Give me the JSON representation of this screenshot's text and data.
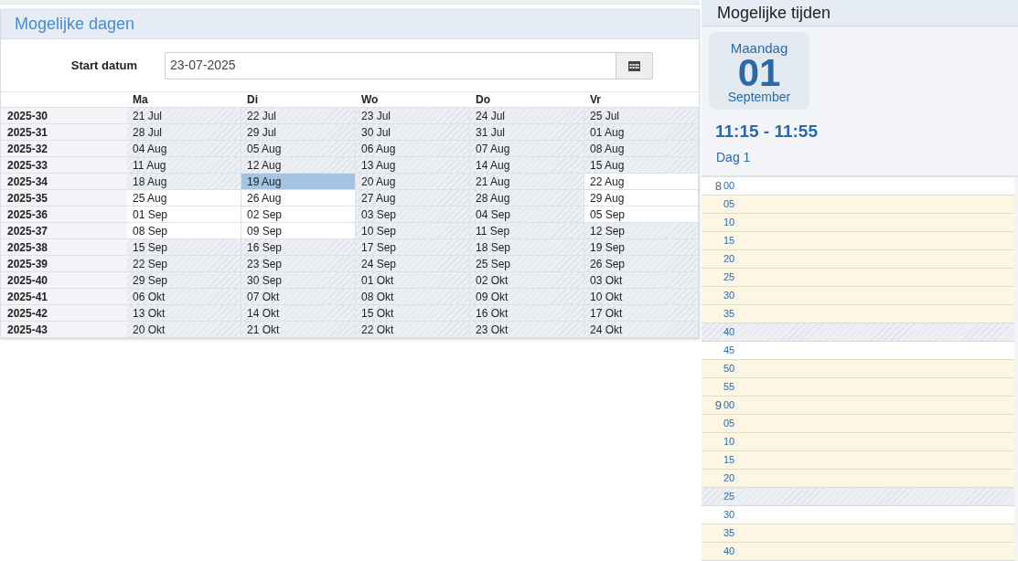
{
  "days_panel": {
    "title": "Mogelijke dagen",
    "start_label": "Start datum",
    "start_value": "23-07-2025",
    "columns": [
      "Ma",
      "Di",
      "Wo",
      "Do",
      "Vr"
    ],
    "rows": [
      {
        "week": "2025-30",
        "cells": [
          {
            "date": "21 Jul",
            "available": false,
            "selected": false
          },
          {
            "date": "22 Jul",
            "available": false,
            "selected": false
          },
          {
            "date": "23 Jul",
            "available": false,
            "selected": false
          },
          {
            "date": "24 Jul",
            "available": false,
            "selected": false
          },
          {
            "date": "25 Jul",
            "available": false,
            "selected": false
          }
        ]
      },
      {
        "week": "2025-31",
        "cells": [
          {
            "date": "28 Jul",
            "available": false,
            "selected": false
          },
          {
            "date": "29 Jul",
            "available": false,
            "selected": false
          },
          {
            "date": "30 Jul",
            "available": false,
            "selected": false
          },
          {
            "date": "31 Jul",
            "available": false,
            "selected": false
          },
          {
            "date": "01 Aug",
            "available": false,
            "selected": false
          }
        ]
      },
      {
        "week": "2025-32",
        "cells": [
          {
            "date": "04 Aug",
            "available": false,
            "selected": false
          },
          {
            "date": "05 Aug",
            "available": false,
            "selected": false
          },
          {
            "date": "06 Aug",
            "available": false,
            "selected": false
          },
          {
            "date": "07 Aug",
            "available": false,
            "selected": false
          },
          {
            "date": "08 Aug",
            "available": false,
            "selected": false
          }
        ]
      },
      {
        "week": "2025-33",
        "cells": [
          {
            "date": "11 Aug",
            "available": false,
            "selected": false
          },
          {
            "date": "12 Aug",
            "available": false,
            "selected": false
          },
          {
            "date": "13 Aug",
            "available": false,
            "selected": false
          },
          {
            "date": "14 Aug",
            "available": false,
            "selected": false
          },
          {
            "date": "15 Aug",
            "available": false,
            "selected": false
          }
        ]
      },
      {
        "week": "2025-34",
        "cells": [
          {
            "date": "18 Aug",
            "available": false,
            "selected": false
          },
          {
            "date": "19 Aug",
            "available": true,
            "selected": true
          },
          {
            "date": "20 Aug",
            "available": false,
            "selected": false
          },
          {
            "date": "21 Aug",
            "available": false,
            "selected": false
          },
          {
            "date": "22 Aug",
            "available": true,
            "selected": false
          }
        ]
      },
      {
        "week": "2025-35",
        "cells": [
          {
            "date": "25 Aug",
            "available": true,
            "selected": false
          },
          {
            "date": "26 Aug",
            "available": true,
            "selected": false
          },
          {
            "date": "27 Aug",
            "available": false,
            "selected": false
          },
          {
            "date": "28 Aug",
            "available": false,
            "selected": false
          },
          {
            "date": "29 Aug",
            "available": true,
            "selected": false
          }
        ]
      },
      {
        "week": "2025-36",
        "cells": [
          {
            "date": "01 Sep",
            "available": true,
            "selected": false
          },
          {
            "date": "02 Sep",
            "available": true,
            "selected": false
          },
          {
            "date": "03 Sep",
            "available": false,
            "selected": false
          },
          {
            "date": "04 Sep",
            "available": false,
            "selected": false
          },
          {
            "date": "05 Sep",
            "available": true,
            "selected": false
          }
        ]
      },
      {
        "week": "2025-37",
        "cells": [
          {
            "date": "08 Sep",
            "available": true,
            "selected": false
          },
          {
            "date": "09 Sep",
            "available": true,
            "selected": false
          },
          {
            "date": "10 Sep",
            "available": false,
            "selected": false
          },
          {
            "date": "11 Sep",
            "available": false,
            "selected": false
          },
          {
            "date": "12 Sep",
            "available": false,
            "selected": false
          }
        ]
      },
      {
        "week": "2025-38",
        "cells": [
          {
            "date": "15 Sep",
            "available": false,
            "selected": false
          },
          {
            "date": "16 Sep",
            "available": false,
            "selected": false
          },
          {
            "date": "17 Sep",
            "available": false,
            "selected": false
          },
          {
            "date": "18 Sep",
            "available": false,
            "selected": false
          },
          {
            "date": "19 Sep",
            "available": false,
            "selected": false
          }
        ]
      },
      {
        "week": "2025-39",
        "cells": [
          {
            "date": "22 Sep",
            "available": false,
            "selected": false
          },
          {
            "date": "23 Sep",
            "available": false,
            "selected": false
          },
          {
            "date": "24 Sep",
            "available": false,
            "selected": false
          },
          {
            "date": "25 Sep",
            "available": false,
            "selected": false
          },
          {
            "date": "26 Sep",
            "available": false,
            "selected": false
          }
        ]
      },
      {
        "week": "2025-40",
        "cells": [
          {
            "date": "29 Sep",
            "available": false,
            "selected": false
          },
          {
            "date": "30 Sep",
            "available": false,
            "selected": false
          },
          {
            "date": "01 Okt",
            "available": false,
            "selected": false
          },
          {
            "date": "02 Okt",
            "available": false,
            "selected": false
          },
          {
            "date": "03 Okt",
            "available": false,
            "selected": false
          }
        ]
      },
      {
        "week": "2025-41",
        "cells": [
          {
            "date": "06 Okt",
            "available": false,
            "selected": false
          },
          {
            "date": "07 Okt",
            "available": false,
            "selected": false
          },
          {
            "date": "08 Okt",
            "available": false,
            "selected": false
          },
          {
            "date": "09 Okt",
            "available": false,
            "selected": false
          },
          {
            "date": "10 Okt",
            "available": false,
            "selected": false
          }
        ]
      },
      {
        "week": "2025-42",
        "cells": [
          {
            "date": "13 Okt",
            "available": false,
            "selected": false
          },
          {
            "date": "14 Okt",
            "available": false,
            "selected": false
          },
          {
            "date": "15 Okt",
            "available": false,
            "selected": false
          },
          {
            "date": "16 Okt",
            "available": false,
            "selected": false
          },
          {
            "date": "17 Okt",
            "available": false,
            "selected": false
          }
        ]
      },
      {
        "week": "2025-43",
        "cells": [
          {
            "date": "20 Okt",
            "available": false,
            "selected": false
          },
          {
            "date": "21 Okt",
            "available": false,
            "selected": false
          },
          {
            "date": "22 Okt",
            "available": false,
            "selected": false
          },
          {
            "date": "23 Okt",
            "available": false,
            "selected": false
          },
          {
            "date": "24 Okt",
            "available": false,
            "selected": false
          }
        ]
      }
    ]
  },
  "times_panel": {
    "title": "Mogelijke tijden",
    "day_name": "Maandag",
    "day_number": "01",
    "month": "September",
    "time_range": "11:15 - 11:55",
    "day_label": "Dag 1",
    "slots": [
      {
        "hour": "8",
        "minute": "00",
        "kind": "free"
      },
      {
        "minute": "05",
        "kind": "busy"
      },
      {
        "minute": "10",
        "kind": "busy"
      },
      {
        "minute": "15",
        "kind": "busy"
      },
      {
        "minute": "20",
        "kind": "busy"
      },
      {
        "minute": "25",
        "kind": "busy"
      },
      {
        "minute": "30",
        "kind": "busy"
      },
      {
        "minute": "35",
        "kind": "busy"
      },
      {
        "minute": "40",
        "kind": "blocked"
      },
      {
        "minute": "45",
        "kind": "free"
      },
      {
        "minute": "50",
        "kind": "busy"
      },
      {
        "minute": "55",
        "kind": "busy"
      },
      {
        "hour": "9",
        "minute": "00",
        "kind": "busy"
      },
      {
        "minute": "05",
        "kind": "busy"
      },
      {
        "minute": "10",
        "kind": "busy"
      },
      {
        "minute": "15",
        "kind": "busy"
      },
      {
        "minute": "20",
        "kind": "busy"
      },
      {
        "minute": "25",
        "kind": "blocked"
      },
      {
        "minute": "30",
        "kind": "free"
      },
      {
        "minute": "35",
        "kind": "busy"
      },
      {
        "minute": "40",
        "kind": "busy"
      }
    ]
  }
}
